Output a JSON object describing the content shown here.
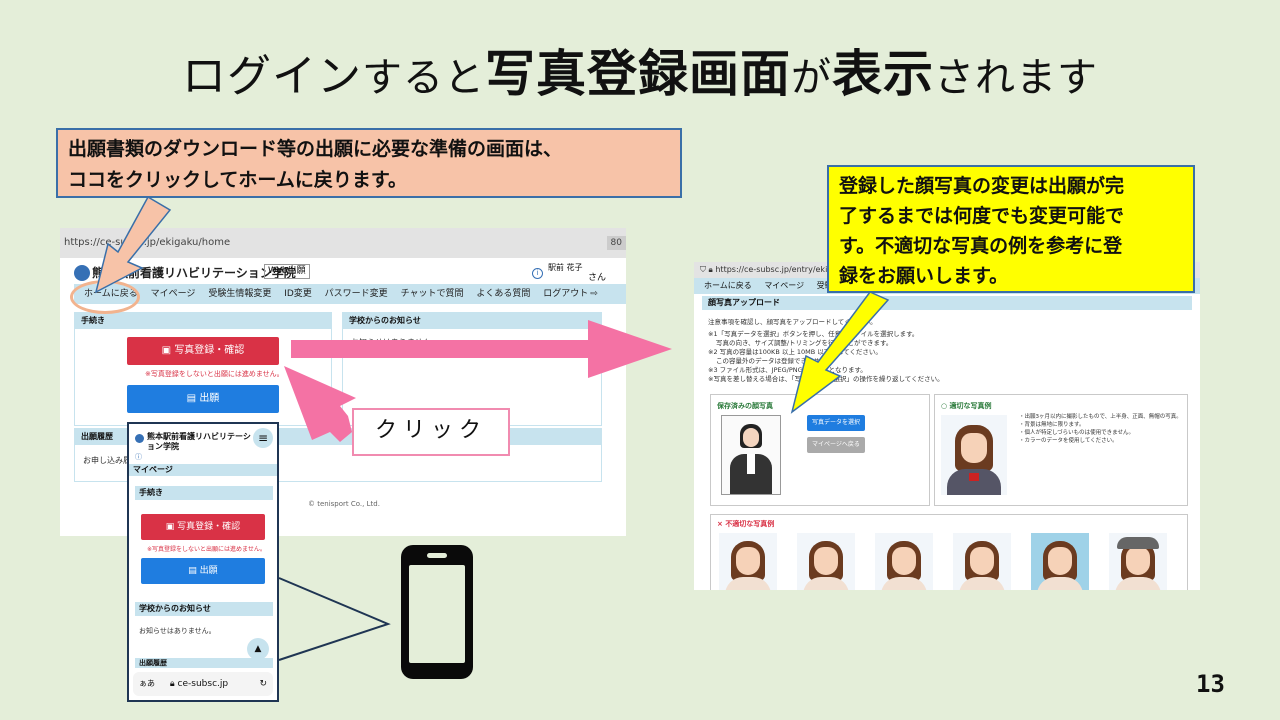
{
  "title": {
    "part1": "ログイン",
    "part2": "すると",
    "part3": "写真登録画面",
    "part4": "が",
    "part5": "表示",
    "part6": "されます"
  },
  "callouts": {
    "home_line1": "出願書類のダウンロード等の出願に必要な準備の画面は、",
    "home_line2": "ココをクリックしてホームに戻ります。",
    "photo_line1": "登録した顔写真の変更は出願が完",
    "photo_line2": "了するまでは何度でも変更可能で",
    "photo_line3": "す。不適切な写真の例を参考に登",
    "photo_line4": "録をお願いします。",
    "click": "クリック"
  },
  "desktop": {
    "url": "https://ce-subsc.jp/ekigaku/home",
    "tab": "80",
    "school": "熊本駅前看護リハビリテーション学院",
    "web_badge": "Web出願",
    "user_name": "駅前 花子",
    "user_suffix": "さん",
    "nav": [
      "ホームに戻る",
      "マイページ",
      "受験生情報変更",
      "ID変更",
      "パスワード変更",
      "チャットで質問",
      "よくある質問",
      "ログアウト"
    ],
    "procedures_header": "手続き",
    "photo_button": "写真登録・確認",
    "photo_note": "※写真登録をしないと出願には進めません。",
    "apply_button": "出願",
    "notice_header": "学校からのお知らせ",
    "notice_text": "お知らせはありません。",
    "history_header": "出願履歴",
    "history_text": "お申し込み履歴",
    "footer": "© tenisport Co., Ltd."
  },
  "mobile": {
    "school": "熊本駅前看護リハビリテーション学院",
    "mypage": "マイページ",
    "procedures_header": "手続き",
    "photo_button": "写真登録・確認",
    "photo_note": "※写真登録をしないと出願には進めません。",
    "apply_button": "出願",
    "notice_header": "学校からのお知らせ",
    "notice_text": "お知らせはありません。",
    "history_header": "出願履歴",
    "url_left": "ぁあ",
    "url": "ce-subsc.jp"
  },
  "photo_page": {
    "url": "https://ce-subsc.jp/entry/ekigaku",
    "nav": [
      "ホームに戻る",
      "マイページ",
      "受験生情"
    ],
    "section_header": "顔写真アップロード",
    "intro": "注意事項を確認し、顔写真をアップロードしてください。",
    "notes": [
      "※1「写真データを選択」ボタンを押し、任意のファイルを選択します。",
      "写真の向き、サイズ調整/トリミングを行うことができます。",
      "※2 写真の容量は100KB 以上 10MB 以下としてください。",
      "この容量外のデータは登録できません。",
      "※3 ファイル形式は、JPEG/PNG形式のみとなります。",
      "※写真を差し替える場合は、「写真データを選択」の操作を繰り返してください。"
    ],
    "saved_header": "保存済みの顔写真",
    "select_button": "写真データを選択",
    "mypage_button": "マイページへ戻る",
    "good_header": "適切な写真例",
    "good_notes": [
      "・出願3ヶ月以内に撮影したもので、上半身、正面、無帽の写真。",
      "・背景は無地に限ります。",
      "・個人が特定しづらいものは使用できません。",
      "・カラーのデータを使用してください。"
    ],
    "bad_header": "不適切な写真例"
  },
  "page_number": "13",
  "colors": {
    "background": "#e4eed9",
    "callout_orange": "#f7c3a8",
    "callout_yellow": "#ffff00",
    "arrow_pink": "#f472a4",
    "button_red": "#d93246",
    "button_blue": "#1f7de0",
    "header_blue": "#c7e3ee"
  }
}
